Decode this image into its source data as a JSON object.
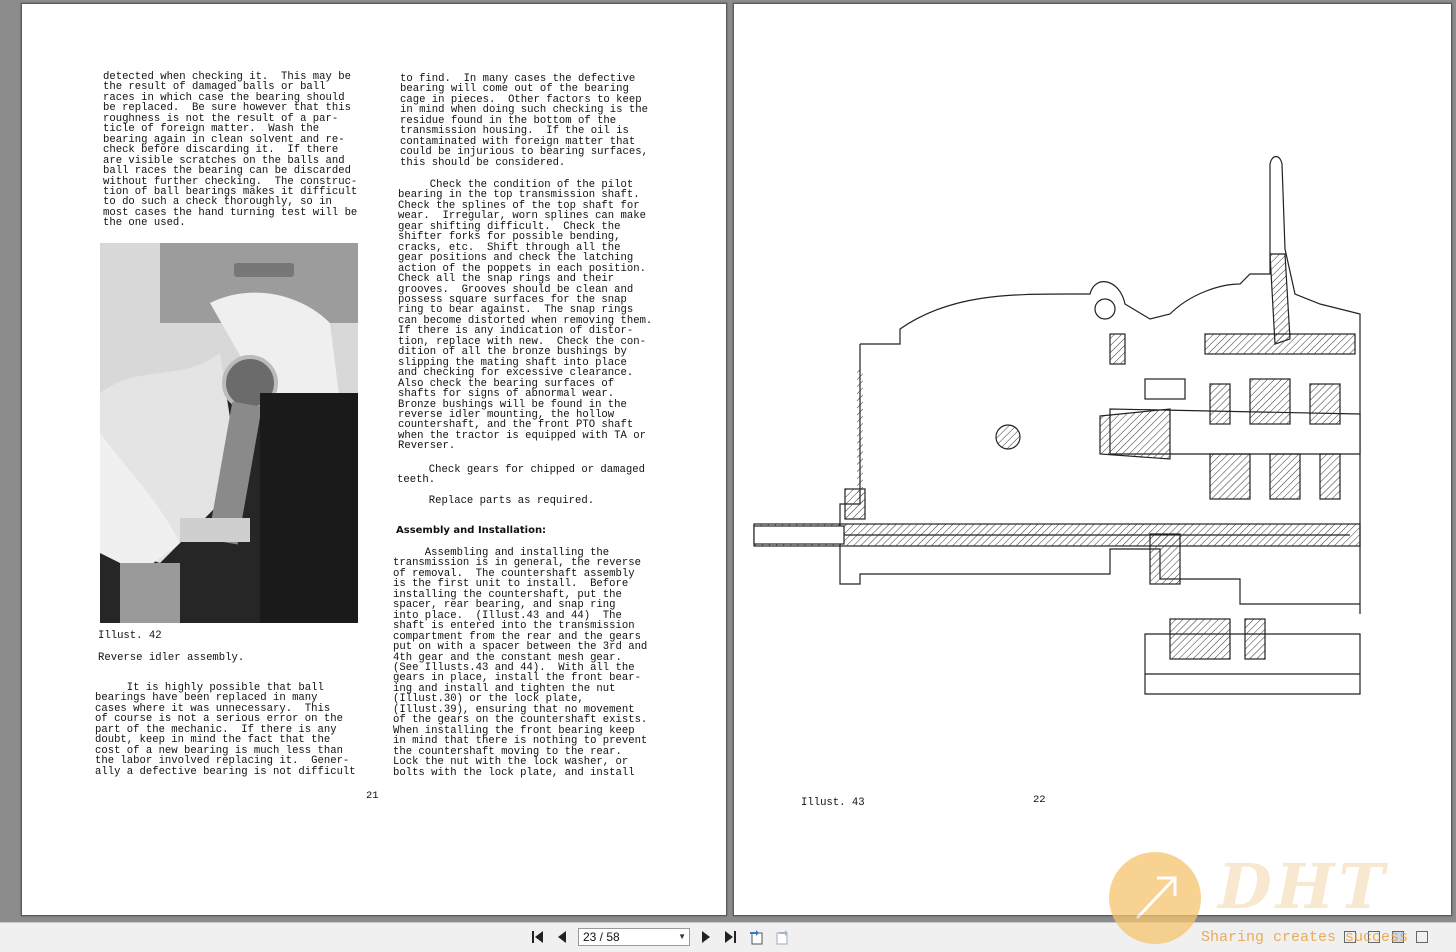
{
  "left_page": {
    "col1": [
      "detected when checking it.  This may be",
      "the result of damaged balls or ball",
      "races in which case the bearing should",
      "be replaced.  Be sure however that this",
      "roughness is not the result of a par-",
      "ticle of foreign matter.  Wash the",
      "bearing again in clean solvent and re-",
      "check before discarding it.  If there",
      "are visible scratches on the balls and",
      "ball races the bearing can be discarded",
      "without further checking.  The construc-",
      "tion of ball bearings makes it difficult",
      "to do such a check thoroughly, so in",
      "most cases the hand turning test will be",
      "the one used."
    ],
    "illust_label": "Illust. 42",
    "illust_caption": "Reverse idler assembly.",
    "col1_bottom": [
      "     It is highly possible that ball",
      "bearings have been replaced in many",
      "cases where it was unnecessary.  This",
      "of course is not a serious error on the",
      "part of the mechanic.  If there is any",
      "doubt, keep in mind the fact that the",
      "cost of a new bearing is much less than",
      "the labor involved replacing it.  Gener-",
      "ally a defective bearing is not difficult"
    ],
    "col2_a": [
      "to find.  In many cases the defective",
      "bearing will come out of the bearing",
      "cage in pieces.  Other factors to keep",
      "in mind when doing such checking is the",
      "residue found in the bottom of the",
      "transmission housing.  If the oil is",
      "contaminated with foreign matter that",
      "could be injurious to bearing surfaces,",
      "this should be considered."
    ],
    "col2_b": [
      "     Check the condition of the pilot",
      "bearing in the top transmission shaft.",
      "Check the splines of the top shaft for",
      "wear.  Irregular, worn splines can make",
      "gear shifting difficult.  Check the",
      "shifter forks for possible bending,",
      "cracks, etc.  Shift through all the",
      "gear positions and check the latching",
      "action of the poppets in each position.",
      "Check all the snap rings and their",
      "grooves.  Grooves should be clean and",
      "possess square surfaces for the snap",
      "ring to bear against.  The snap rings",
      "can become distorted when removing them.",
      "If there is any indication of distor-",
      "tion, replace with new.  Check the con-",
      "dition of all the bronze bushings by",
      "slipping the mating shaft into place",
      "and checking for excessive clearance.",
      "Also check the bearing surfaces of",
      "shafts for signs of abnormal wear.",
      "Bronze bushings will be found in the",
      "reverse idler mounting, the hollow",
      "countershaft, and the front PTO shaft",
      "when the tractor is equipped with TA or",
      "Reverser."
    ],
    "col2_c": [
      "     Check gears for chipped or damaged",
      "teeth."
    ],
    "col2_d": "     Replace parts as required.",
    "heading": "Assembly and Installation:",
    "col2_e": [
      "     Assembling and installing the",
      "transmission is in general, the reverse",
      "of removal.  The countershaft assembly",
      "is the first unit to install.  Before",
      "installing the countershaft, put the",
      "spacer, rear bearing, and snap ring",
      "into place.  (Illust.43 and 44)  The",
      "shaft is entered into the transmission",
      "compartment from the rear and the gears",
      "put on with a spacer between the 3rd and",
      "4th gear and the constant mesh gear.",
      "(See Illusts.43 and 44).  With all the",
      "gears in place, install the front bear-",
      "ing and install and tighten the nut",
      "(Illust.30) or the lock plate,",
      "(Illust.39), ensuring that no movement",
      "of the gears on the countershaft exists.",
      "When installing the front bearing keep",
      "in mind that there is nothing to prevent",
      "the countershaft moving to the rear.",
      "Lock the nut with the lock washer, or",
      "bolts with the lock plate, and install"
    ],
    "page_number": "21"
  },
  "right_page": {
    "illust_label": "Illust. 43",
    "page_number": "22"
  },
  "toolbar": {
    "page_field_value": "23 / 58"
  },
  "watermark": {
    "logo_text": "DHT",
    "slogan": "Sharing creates success"
  },
  "icons": {
    "first": "first-page-icon",
    "prev": "previous-page-icon",
    "next": "next-page-icon",
    "last": "last-page-icon"
  },
  "colors": {
    "viewer_bg": "#8c8c8c",
    "toolbar_bg": "#f0f0f0",
    "watermark": "#e8a040"
  }
}
